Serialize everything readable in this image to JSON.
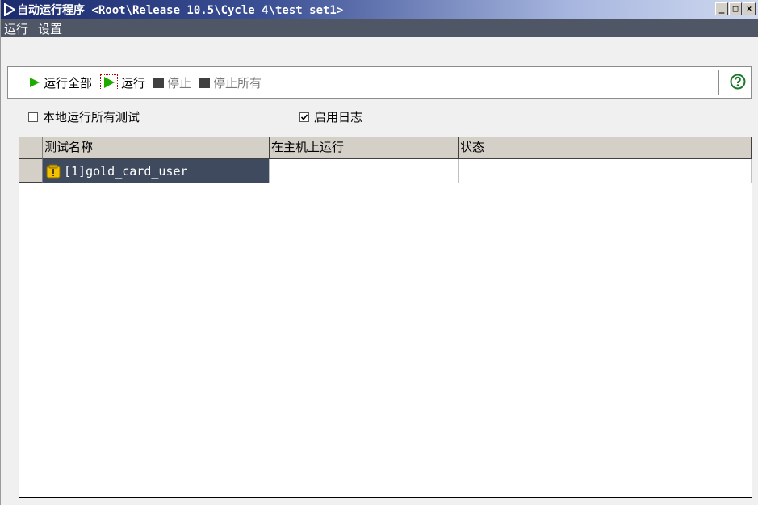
{
  "window": {
    "title": "自动运行程序 <Root\\Release 10.5\\Cycle 4\\test set1>",
    "buttons": {
      "minimize": "_",
      "maximize": "□",
      "close": "×"
    }
  },
  "menu": {
    "items": [
      "运行",
      "设置"
    ]
  },
  "toolbar": {
    "run_all": "运行全部",
    "run": "运行",
    "stop": "停止",
    "stop_all": "停止所有"
  },
  "options": {
    "run_all_local": {
      "label": "本地运行所有测试",
      "checked": false
    },
    "enable_log": {
      "label": "启用日志",
      "checked": true
    }
  },
  "grid": {
    "columns": [
      "测试名称",
      "在主机上运行",
      "状态"
    ],
    "rows": [
      {
        "name": "[1]gold_card_user",
        "host": "",
        "status": ""
      }
    ]
  },
  "colors": {
    "accent_green": "#1faa00",
    "titlebar_dark": "#1c2b6e",
    "menubar": "#4f5666",
    "selection": "#3f4a5f"
  }
}
